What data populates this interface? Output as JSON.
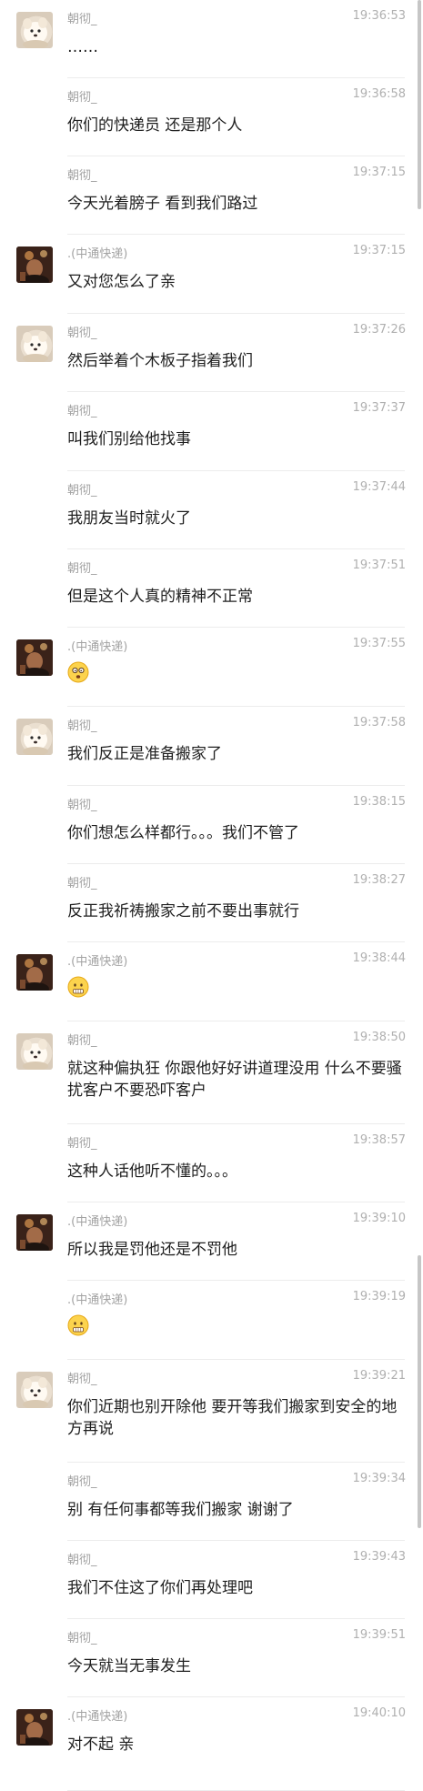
{
  "messages": [
    {
      "sender": "朝彻_",
      "time": "19:36:53",
      "text": "……",
      "avatar": "dog-avatar",
      "show_avatar": true,
      "emoji": null
    },
    {
      "sender": "朝彻_",
      "time": "19:36:58",
      "text": "你们的快递员 还是那个人",
      "avatar": "dog-avatar",
      "show_avatar": false,
      "emoji": null
    },
    {
      "sender": "朝彻_",
      "time": "19:37:15",
      "text": "今天光着膀子 看到我们路过",
      "avatar": "dog-avatar",
      "show_avatar": false,
      "emoji": null
    },
    {
      "sender": ".(中通快递)",
      "time": "19:37:15",
      "text": "又对您怎么了亲",
      "avatar": "courier-avatar",
      "show_avatar": true,
      "emoji": null
    },
    {
      "sender": "朝彻_",
      "time": "19:37:26",
      "text": "然后举着个木板子指着我们",
      "avatar": "dog-avatar",
      "show_avatar": true,
      "emoji": null
    },
    {
      "sender": "朝彻_",
      "time": "19:37:37",
      "text": "叫我们别给他找事",
      "avatar": "dog-avatar",
      "show_avatar": false,
      "emoji": null
    },
    {
      "sender": "朝彻_",
      "time": "19:37:44",
      "text": "我朋友当时就火了",
      "avatar": "dog-avatar",
      "show_avatar": false,
      "emoji": null
    },
    {
      "sender": "朝彻_",
      "time": "19:37:51",
      "text": "但是这个人真的精神不正常",
      "avatar": "dog-avatar",
      "show_avatar": false,
      "emoji": null
    },
    {
      "sender": ".(中通快递)",
      "time": "19:37:55",
      "text": "",
      "avatar": "courier-avatar",
      "show_avatar": true,
      "emoji": "dizzy-face-emoji"
    },
    {
      "sender": "朝彻_",
      "time": "19:37:58",
      "text": "我们反正是准备搬家了",
      "avatar": "dog-avatar",
      "show_avatar": true,
      "emoji": null
    },
    {
      "sender": "朝彻_",
      "time": "19:38:15",
      "text": "你们想怎么样都行。。。我们不管了",
      "avatar": "dog-avatar",
      "show_avatar": false,
      "emoji": null
    },
    {
      "sender": "朝彻_",
      "time": "19:38:27",
      "text": "反正我祈祷搬家之前不要出事就行",
      "avatar": "dog-avatar",
      "show_avatar": false,
      "emoji": null
    },
    {
      "sender": ".(中通快递)",
      "time": "19:38:44",
      "text": "",
      "avatar": "courier-avatar",
      "show_avatar": true,
      "emoji": "grimace-emoji"
    },
    {
      "sender": "朝彻_",
      "time": "19:38:50",
      "text": "就这种偏执狂 你跟他好好讲道理没用 什么不要骚扰客户不要恐吓客户",
      "avatar": "dog-avatar",
      "show_avatar": true,
      "emoji": null
    },
    {
      "sender": "朝彻_",
      "time": "19:38:57",
      "text": "这种人话他听不懂的。。。",
      "avatar": "dog-avatar",
      "show_avatar": false,
      "emoji": null
    },
    {
      "sender": ".(中通快递)",
      "time": "19:39:10",
      "text": "所以我是罚他还是不罚他",
      "avatar": "courier-avatar",
      "show_avatar": true,
      "emoji": null
    },
    {
      "sender": ".(中通快递)",
      "time": "19:39:19",
      "text": "",
      "avatar": "courier-avatar",
      "show_avatar": false,
      "emoji": "grimace-emoji"
    },
    {
      "sender": "朝彻_",
      "time": "19:39:21",
      "text": "你们近期也别开除他 要开等我们搬家到安全的地方再说",
      "avatar": "dog-avatar",
      "show_avatar": true,
      "emoji": null
    },
    {
      "sender": "朝彻_",
      "time": "19:39:34",
      "text": "别 有任何事都等我们搬家 谢谢了",
      "avatar": "dog-avatar",
      "show_avatar": false,
      "emoji": null
    },
    {
      "sender": "朝彻_",
      "time": "19:39:43",
      "text": "我们不住这了你们再处理吧",
      "avatar": "dog-avatar",
      "show_avatar": false,
      "emoji": null
    },
    {
      "sender": "朝彻_",
      "time": "19:39:51",
      "text": "今天就当无事发生",
      "avatar": "dog-avatar",
      "show_avatar": false,
      "emoji": null
    },
    {
      "sender": ".(中通快递)",
      "time": "19:40:10",
      "text": "对不起 亲",
      "avatar": "courier-avatar",
      "show_avatar": true,
      "emoji": null
    }
  ]
}
